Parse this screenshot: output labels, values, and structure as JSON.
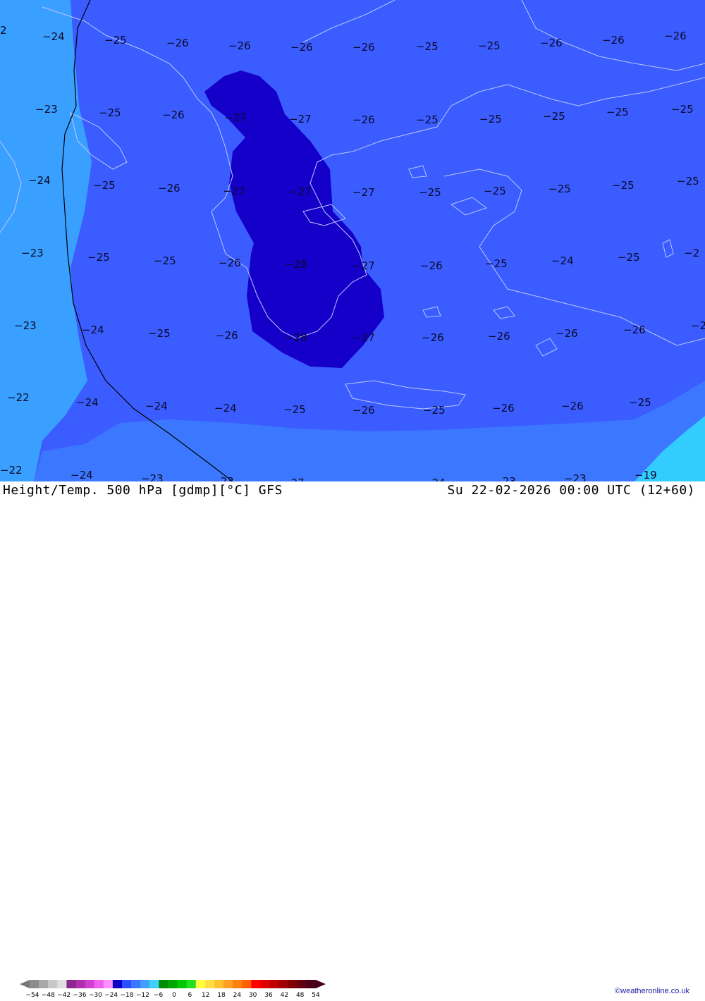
{
  "map": {
    "region": "Greece / Balkans / Aegean",
    "colors": {
      "outer_light": "#3aa0ff",
      "main": "#3b5cff",
      "core": "#1500c9",
      "corner_cyan": "#33ccff",
      "coast": "#b9c8ff",
      "border": "#000000"
    },
    "labels": [
      "2",
      "-24",
      "-25",
      "-26",
      "-26",
      "-26",
      "-26",
      "-25",
      "-25",
      "-26",
      "-26",
      "-26",
      "-23",
      "-25",
      "-26",
      "-27",
      "-27",
      "-26",
      "-25",
      "-25",
      "-25",
      "-25",
      "-25",
      "-24",
      "-25",
      "-26",
      "-27",
      "-27",
      "-27",
      "-25",
      "-25",
      "-25",
      "-25",
      "-25",
      "-23",
      "-25",
      "-25",
      "-26",
      "-28",
      "-27",
      "-26",
      "-25",
      "-24",
      "-25",
      "-2",
      "-23",
      "-24",
      "-25",
      "-26",
      "-28",
      "-27",
      "-26",
      "-26",
      "-26",
      "-26",
      "-2",
      "-22",
      "-24",
      "-24",
      "-24",
      "-25",
      "-26",
      "-25",
      "-26",
      "-26",
      "-25",
      "-22",
      "-24",
      "-23",
      "-23",
      "-27",
      "-24",
      "-23",
      "-23",
      "-19"
    ]
  },
  "footer": {
    "left_title": "Height/Temp. 500 hPa [gdmp][°C] GFS",
    "right_title": "Su 22-02-2026 00:00 UTC (12+60)",
    "credit": "©weatheronline.co.uk",
    "colorbar_ticks": [
      "-54",
      "-48",
      "-42",
      "-36",
      "-30",
      "-24",
      "-18",
      "-12",
      "-6",
      "0",
      "6",
      "12",
      "18",
      "24",
      "30",
      "36",
      "42",
      "48",
      "54"
    ],
    "colorbar_colors": [
      "#8c8c8c",
      "#a8a8a8",
      "#c8c8c8",
      "#e0e0e0",
      "#8a2a8a",
      "#b030b0",
      "#d040d0",
      "#f060f0",
      "#ff90ff",
      "#0c00c8",
      "#2850ff",
      "#3c78ff",
      "#40a0ff",
      "#40d0ff",
      "#008c00",
      "#00a800",
      "#00c800",
      "#20e020",
      "#ffff40",
      "#ffe040",
      "#ffc030",
      "#ffa020",
      "#ff8010",
      "#ff6000",
      "#ff0000",
      "#e00000",
      "#c00000",
      "#a00000",
      "#800000",
      "#600010",
      "#480018"
    ]
  }
}
